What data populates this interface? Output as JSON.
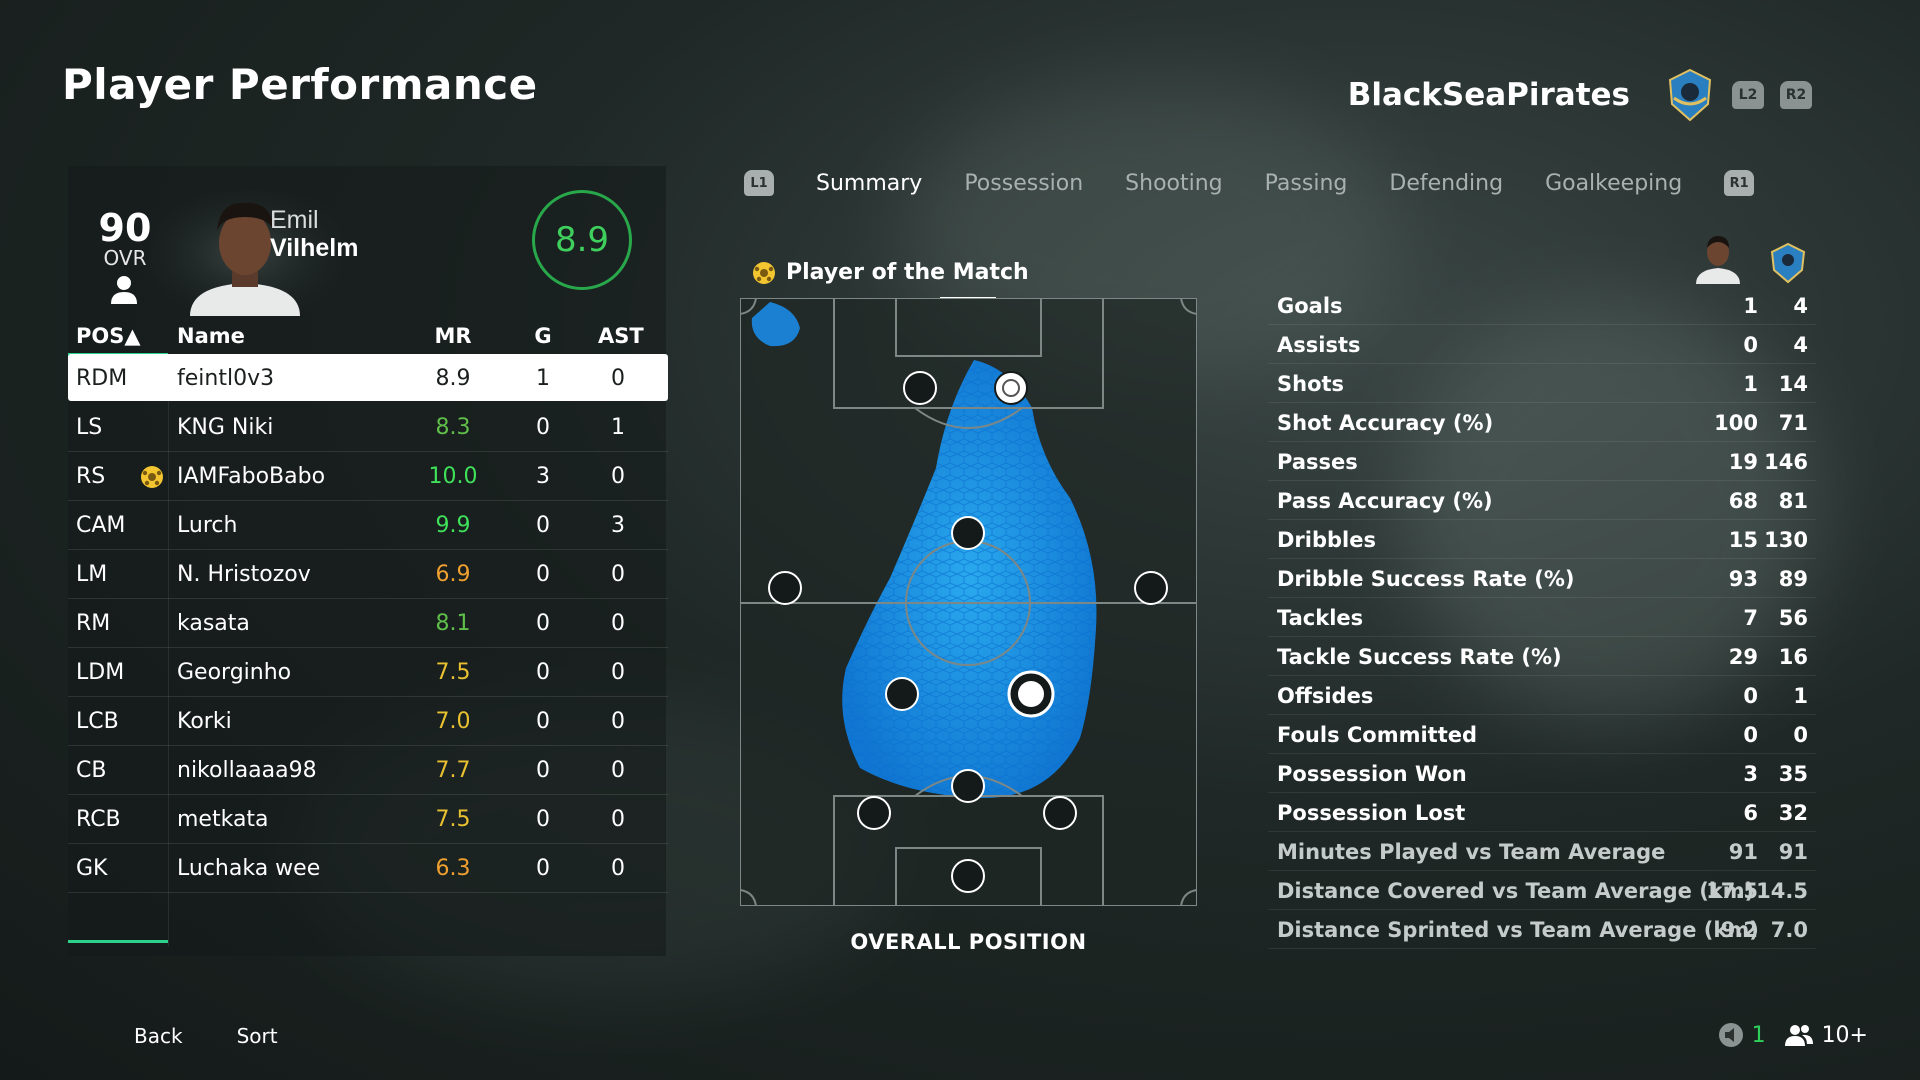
{
  "page": {
    "title": "Player Performance",
    "team_name": "BlackSeaPirates",
    "l2": "L2",
    "r2": "R2"
  },
  "player": {
    "ovr": "90",
    "ovr_label": "OVR",
    "first_name": "Emil",
    "last_name": "Vilhelm",
    "rating": "8.9"
  },
  "table": {
    "headers": {
      "pos": "POS▲",
      "name": "Name",
      "mr": "MR",
      "g": "G",
      "ast": "AST"
    },
    "rows": [
      {
        "pos": "RDM",
        "name": "feintl0v3",
        "mr": "8.9",
        "g": "1",
        "ast": "0",
        "mr_color": "#1b1f1e",
        "motm": false
      },
      {
        "pos": "LS",
        "name": "KNG Niki",
        "mr": "8.3",
        "g": "0",
        "ast": "1",
        "mr_color": "#5fbf4a",
        "motm": false
      },
      {
        "pos": "RS",
        "name": "IAMFaboBabo",
        "mr": "10.0",
        "g": "3",
        "ast": "0",
        "mr_color": "#3fe05a",
        "motm": true
      },
      {
        "pos": "CAM",
        "name": "Lurch",
        "mr": "9.9",
        "g": "0",
        "ast": "3",
        "mr_color": "#3fe05a",
        "motm": false
      },
      {
        "pos": "LM",
        "name": "N. Hristozov",
        "mr": "6.9",
        "g": "0",
        "ast": "0",
        "mr_color": "#f0a030",
        "motm": false
      },
      {
        "pos": "RM",
        "name": "kasata",
        "mr": "8.1",
        "g": "0",
        "ast": "0",
        "mr_color": "#5fbf4a",
        "motm": false
      },
      {
        "pos": "LDM",
        "name": "Georginho",
        "mr": "7.5",
        "g": "0",
        "ast": "0",
        "mr_color": "#e8c030",
        "motm": false
      },
      {
        "pos": "LCB",
        "name": "Korki",
        "mr": "7.0",
        "g": "0",
        "ast": "0",
        "mr_color": "#e8c030",
        "motm": false
      },
      {
        "pos": "CB",
        "name": "nikollaaaa98",
        "mr": "7.7",
        "g": "0",
        "ast": "0",
        "mr_color": "#e8c030",
        "motm": false
      },
      {
        "pos": "RCB",
        "name": "metkata",
        "mr": "7.5",
        "g": "0",
        "ast": "0",
        "mr_color": "#e8c030",
        "motm": false
      },
      {
        "pos": "GK",
        "name": "Luchaka wee",
        "mr": "6.3",
        "g": "0",
        "ast": "0",
        "mr_color": "#f0a030",
        "motm": false
      }
    ]
  },
  "tabs": {
    "l1": "L1",
    "r1": "R1",
    "items": [
      "Summary",
      "Possession",
      "Shooting",
      "Passing",
      "Defending",
      "Goalkeeping"
    ],
    "active": "Summary"
  },
  "potm": {
    "label": "Player of the Match"
  },
  "pitch": {
    "caption": "OVERALL POSITION"
  },
  "stats": [
    {
      "label": "Goals",
      "player": "1",
      "team": "4"
    },
    {
      "label": "Assists",
      "player": "0",
      "team": "4"
    },
    {
      "label": "Shots",
      "player": "1",
      "team": "14"
    },
    {
      "label": "Shot Accuracy (%)",
      "player": "100",
      "team": "71"
    },
    {
      "label": "Passes",
      "player": "19",
      "team": "146"
    },
    {
      "label": "Pass Accuracy (%)",
      "player": "68",
      "team": "81"
    },
    {
      "label": "Dribbles",
      "player": "15",
      "team": "130"
    },
    {
      "label": "Dribble Success Rate (%)",
      "player": "93",
      "team": "89"
    },
    {
      "label": "Tackles",
      "player": "7",
      "team": "56"
    },
    {
      "label": "Tackle Success Rate (%)",
      "player": "29",
      "team": "16"
    },
    {
      "label": "Offsides",
      "player": "0",
      "team": "1"
    },
    {
      "label": "Fouls Committed",
      "player": "0",
      "team": "0"
    },
    {
      "label": "Possession Won",
      "player": "3",
      "team": "35"
    },
    {
      "label": "Possession Lost",
      "player": "6",
      "team": "32"
    },
    {
      "label": "Minutes Played vs Team Average",
      "player": "91",
      "team": "91"
    },
    {
      "label": "Distance Covered vs Team Average (km)",
      "player": "17.5",
      "team": "14.5"
    },
    {
      "label": "Distance Sprinted vs Team Average (km)",
      "player": "9.2",
      "team": "7.0"
    }
  ],
  "footer": {
    "back": "Back",
    "sort": "Sort",
    "mic_count": "1",
    "players_count": "10+"
  },
  "colors": {
    "accent": "#2ed18a",
    "rating_green": "#3fcf5d",
    "heatmap": "#1aa0ff"
  }
}
